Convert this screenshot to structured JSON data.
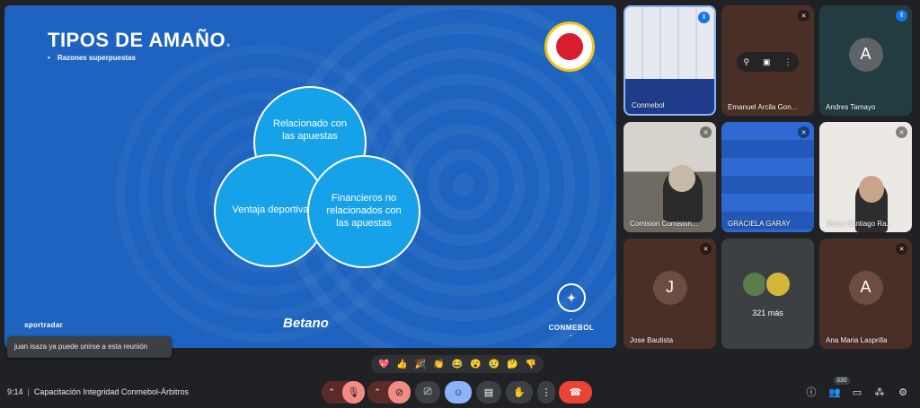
{
  "slide": {
    "title": "TIPOS DE AMAÑO",
    "title_dot": ".",
    "bullet": "Razones superpuestas",
    "circles": [
      "Relacionado con las apuestas",
      "Ventaja deportiva",
      "Financieros no relacionados con las apuestas"
    ],
    "sponsor_left": "sportradar",
    "sponsor_center": "Betano",
    "brand_right": "· CONMEBOL ·"
  },
  "notification": "juan isaza ya puede unirse a esta reunión",
  "participants": [
    {
      "name": "Conmebol",
      "status": "speaking"
    },
    {
      "name": "Emanuel Arcila Gon...",
      "status": "muted"
    },
    {
      "name": "Andres Tamayo",
      "initial": "A",
      "status": "speaking"
    },
    {
      "name": "Comision Comision...",
      "status": "muted"
    },
    {
      "name": "GRACIELA GARAY",
      "status": "muted"
    },
    {
      "name": "Oscar Santiago Ra...",
      "status": "muted"
    },
    {
      "name": "Jose Bautista",
      "initial": "J",
      "status": "muted"
    },
    {
      "name": "321 más"
    },
    {
      "name": "Ana Maria Lasprilla",
      "initial": "A",
      "status": "muted"
    }
  ],
  "reactions": [
    "💖",
    "👍",
    "🎉",
    "👏",
    "😂",
    "😮",
    "😢",
    "🤔",
    "👎"
  ],
  "meeting": {
    "time": "9:14",
    "separator": "|",
    "title": "Capacitación Integridad Conmebol-Árbitros"
  },
  "participant_count": "330",
  "colors": {
    "slide_bg": "#1d63bf",
    "circle": "#16a2e8",
    "leave": "#ea4335",
    "muted_btn": "#f28b82",
    "active_btn": "#8ab4f8"
  }
}
